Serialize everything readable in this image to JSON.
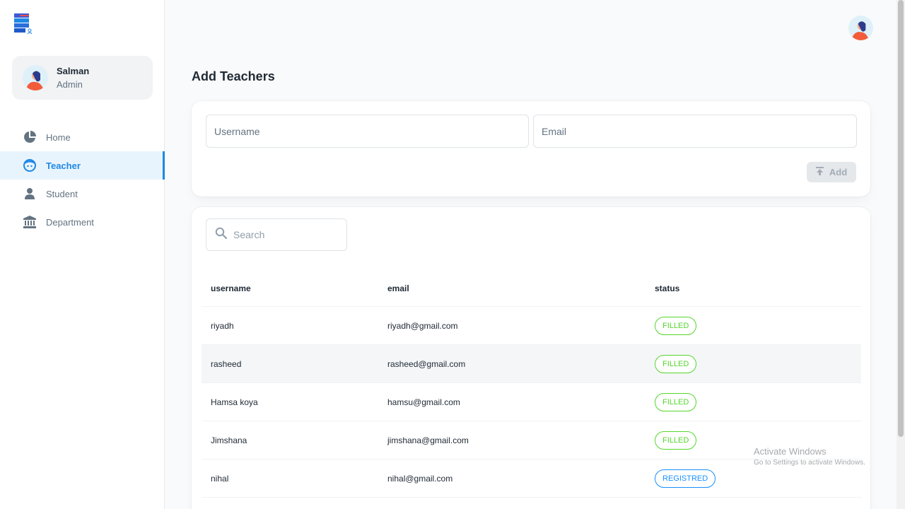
{
  "sidebar": {
    "user": {
      "name": "Salman",
      "role": "Admin"
    },
    "items": [
      {
        "label": "Home",
        "icon": "pie-chart-icon",
        "active": false
      },
      {
        "label": "Teacher",
        "icon": "face-icon",
        "active": true
      },
      {
        "label": "Student",
        "icon": "person-icon",
        "active": false
      },
      {
        "label": "Department",
        "icon": "bank-icon",
        "active": false
      }
    ]
  },
  "main": {
    "title": "Add Teachers",
    "form": {
      "username_placeholder": "Username",
      "email_placeholder": "Email",
      "add_label": "Add"
    },
    "search": {
      "placeholder": "Search"
    },
    "table": {
      "columns": [
        "username",
        "email",
        "status"
      ],
      "rows": [
        {
          "username": "riyadh",
          "email": "riyadh@gmail.com",
          "status": "FILLED"
        },
        {
          "username": "rasheed",
          "email": "rasheed@gmail.com",
          "status": "FILLED"
        },
        {
          "username": "Hamsa koya",
          "email": "hamsu@gmail.com",
          "status": "FILLED"
        },
        {
          "username": "Jimshana",
          "email": "jimshana@gmail.com",
          "status": "FILLED"
        },
        {
          "username": "nihal",
          "email": "nihal@gmail.com",
          "status": "REGISTRED"
        }
      ]
    }
  },
  "watermark": {
    "line1": "Activate Windows",
    "line2": "Go to Settings to activate Windows."
  },
  "colors": {
    "accent": "#1e88e5",
    "filled": "#54d62c",
    "registered": "#1890ff"
  }
}
